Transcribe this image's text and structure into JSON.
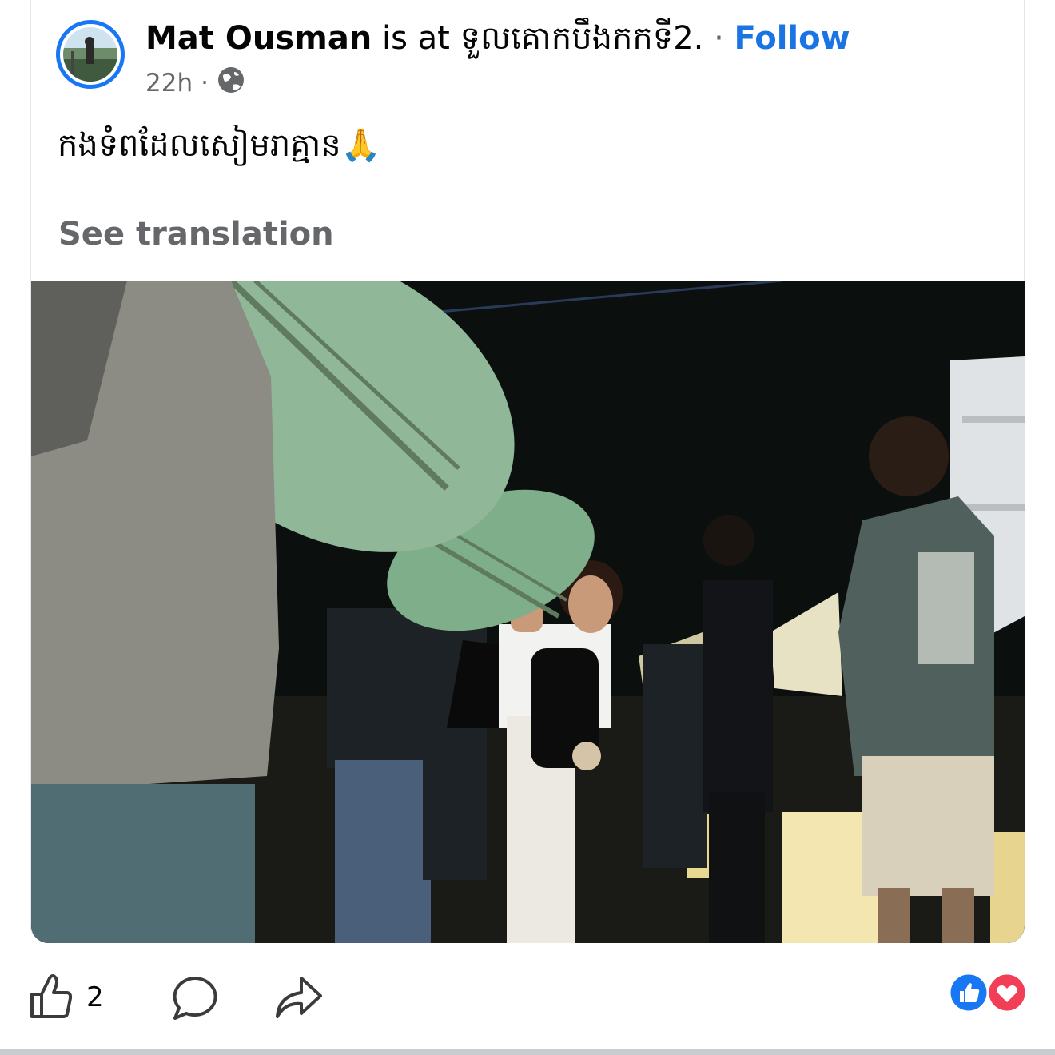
{
  "post": {
    "author": "Mat Ousman",
    "location_prefix": "is at",
    "location": "ទួលគោកបឹងកកទី2.",
    "separator": "·",
    "follow_label": "Follow",
    "timestamp": "22h",
    "meta_separator": "·",
    "audience_icon": "globe-icon",
    "text": "កងទំពដែលសៀមរាគ្មាន",
    "emoji": "🙏",
    "see_translation_label": "See translation"
  },
  "actions": {
    "like_icon": "thumbs-up-icon",
    "like_count": "2",
    "comment_icon": "comment-bubble-icon",
    "share_icon": "share-arrow-icon"
  },
  "reactions": [
    "like-reaction-icon",
    "love-reaction-icon"
  ],
  "colors": {
    "accent": "#1b74e4",
    "muted": "#65676b",
    "love": "#f33e58"
  }
}
